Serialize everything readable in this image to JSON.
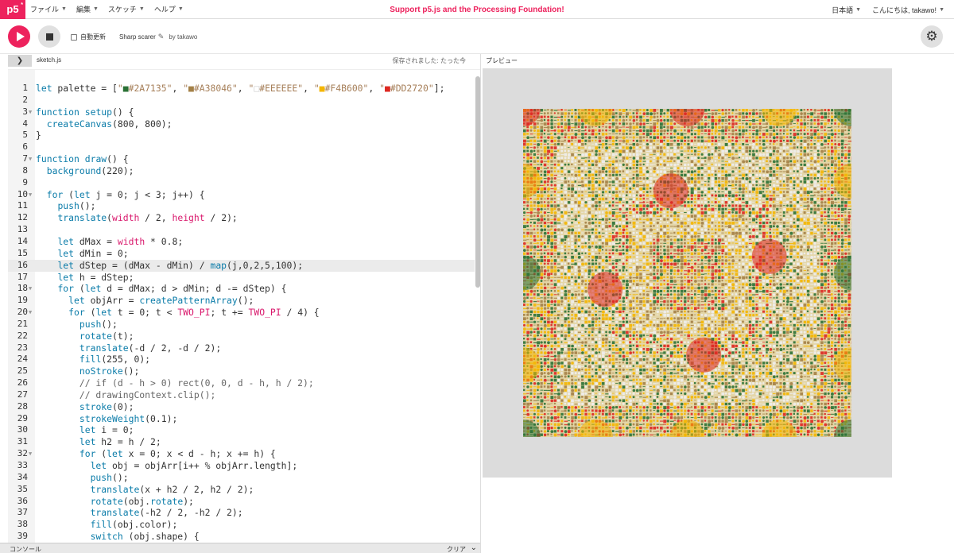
{
  "nav": {
    "logo": "p5",
    "logo_sup": "*",
    "menus": [
      "ファイル",
      "編集",
      "スケッチ",
      "ヘルプ"
    ],
    "banner": "Support p5.js and the Processing Foundation!",
    "language": "日本語",
    "greeting": "こんにちは, takawo!"
  },
  "toolbar": {
    "autorefresh_label": "自動更新",
    "sketch_name": "Sharp scarer",
    "author": "by takawo"
  },
  "editor": {
    "file_tab": "sketch.js",
    "saved_status": "保存されました: たった今",
    "active_line": 16,
    "lines": [
      "let palette = [\"■#2A7135\", \"■#A38046\", \"□#EEEEEE\", \"■#F4B600\", \"■#DD2720\"];",
      "",
      "function setup() {",
      "  createCanvas(800, 800);",
      "}",
      "",
      "function draw() {",
      "  background(220);",
      "",
      "  for (let j = 0; j < 3; j++) {",
      "    push();",
      "    translate(width / 2, height / 2);",
      "",
      "    let dMax = width * 0.8;",
      "    let dMin = 0;",
      "    let dStep = (dMax - dMin) / map(j,0,2,5,100);",
      "    let h = dStep;",
      "    for (let d = dMax; d > dMin; d -= dStep) {",
      "      let objArr = createPatternArray();",
      "      for (let t = 0; t < TWO_PI; t += TWO_PI / 4) {",
      "        push();",
      "        rotate(t);",
      "        translate(-d / 2, -d / 2);",
      "        fill(255, 0);",
      "        noStroke();",
      "        // if (d - h > 0) rect(0, 0, d - h, h / 2);",
      "        // drawingContext.clip();",
      "        stroke(0);",
      "        strokeWeight(0.1);",
      "        let i = 0;",
      "        let h2 = h / 2;",
      "        for (let x = 0; x < d - h; x += h) {",
      "          let obj = objArr[i++ % objArr.length];",
      "          push();",
      "          translate(x + h2 / 2, h2 / 2);",
      "          rotate(obj.rotate);",
      "          translate(-h2 / 2, -h2 / 2);",
      "          fill(obj.color);",
      "          switch (obj.shape) {"
    ],
    "fold_lines": [
      3,
      7,
      10,
      18,
      20,
      32
    ]
  },
  "preview": {
    "label": "プレビュー",
    "palette": [
      "#2A7135",
      "#A38046",
      "#EEEEEE",
      "#F4B600",
      "#DD2720"
    ]
  },
  "console": {
    "title": "コンソール",
    "clear_label": "クリア"
  }
}
